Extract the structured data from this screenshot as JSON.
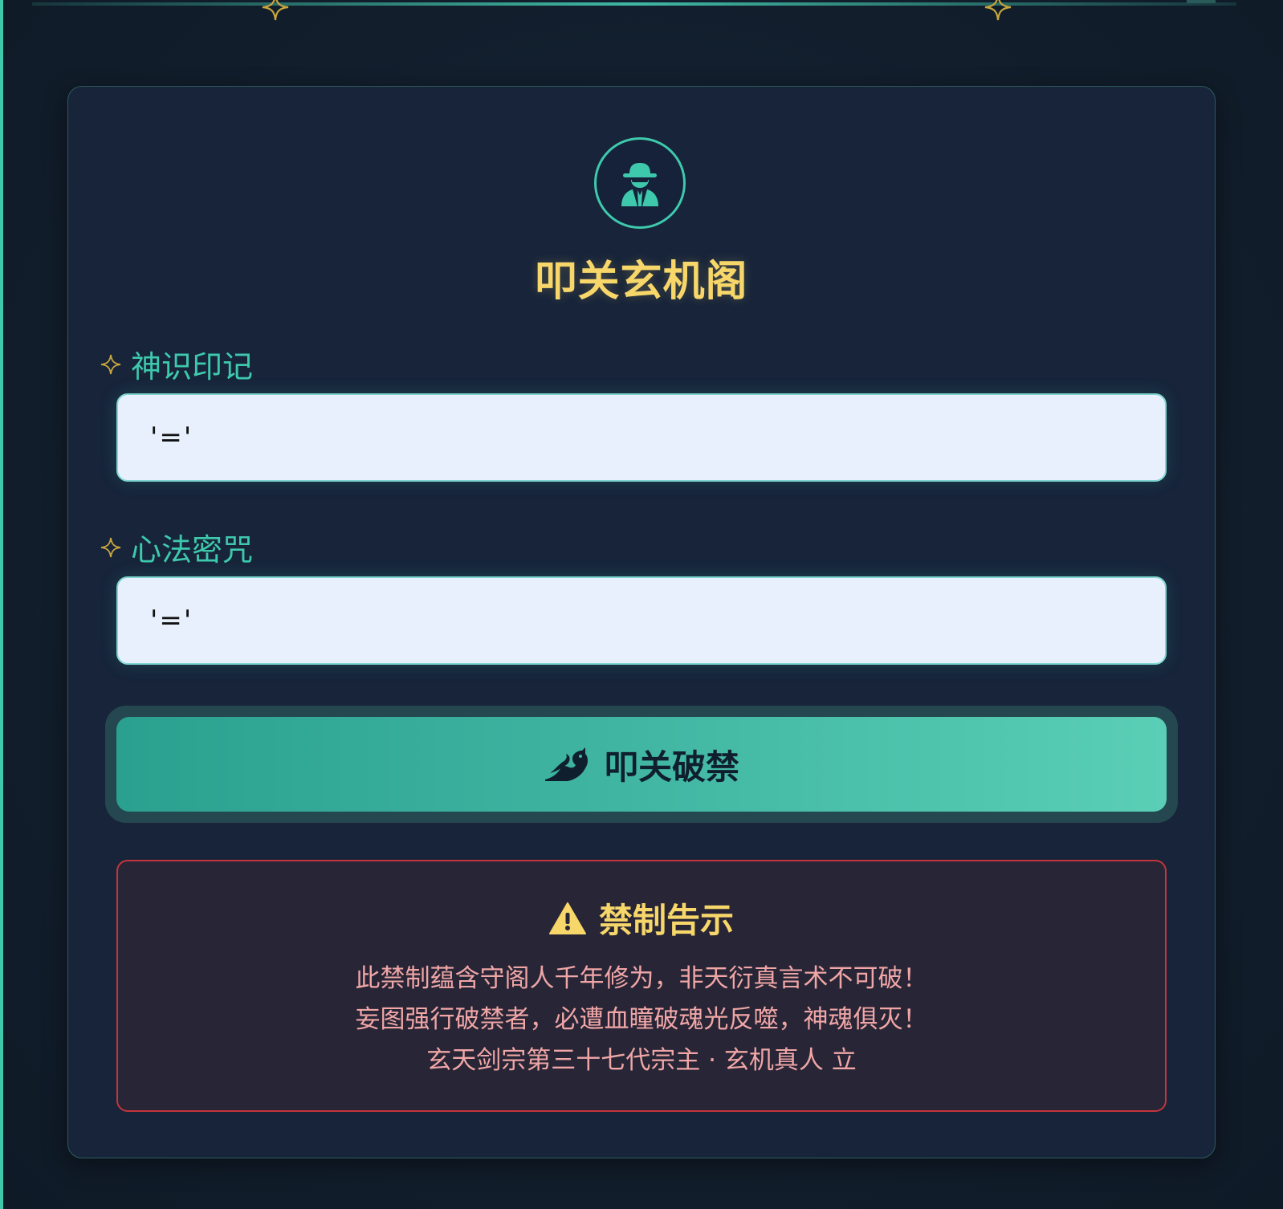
{
  "header": {
    "title": "叩关玄机阁",
    "emblem_icon": "spy-icon"
  },
  "form": {
    "username": {
      "label": "神识印记",
      "value": "'='"
    },
    "password": {
      "label": "心法密咒",
      "value": "'='"
    },
    "submit": {
      "label": "叩关破禁",
      "icon": "dragon-icon"
    }
  },
  "warning": {
    "icon": "warning-triangle-icon",
    "title": "禁制告示",
    "lines": [
      "此禁制蕴含守阁人千年修为，非天衍真言术不可破！",
      "妄图强行破禁者，必遭血瞳破魂光反噬，神魂俱灭！",
      "玄天剑宗第三十七代宗主 · 玄机真人 立"
    ]
  },
  "colors": {
    "accent": "#3ec9ad",
    "gold": "#f7d66a",
    "danger": "#c4353c",
    "warning_text": "#f0a6a6",
    "background": "#121e2c"
  }
}
